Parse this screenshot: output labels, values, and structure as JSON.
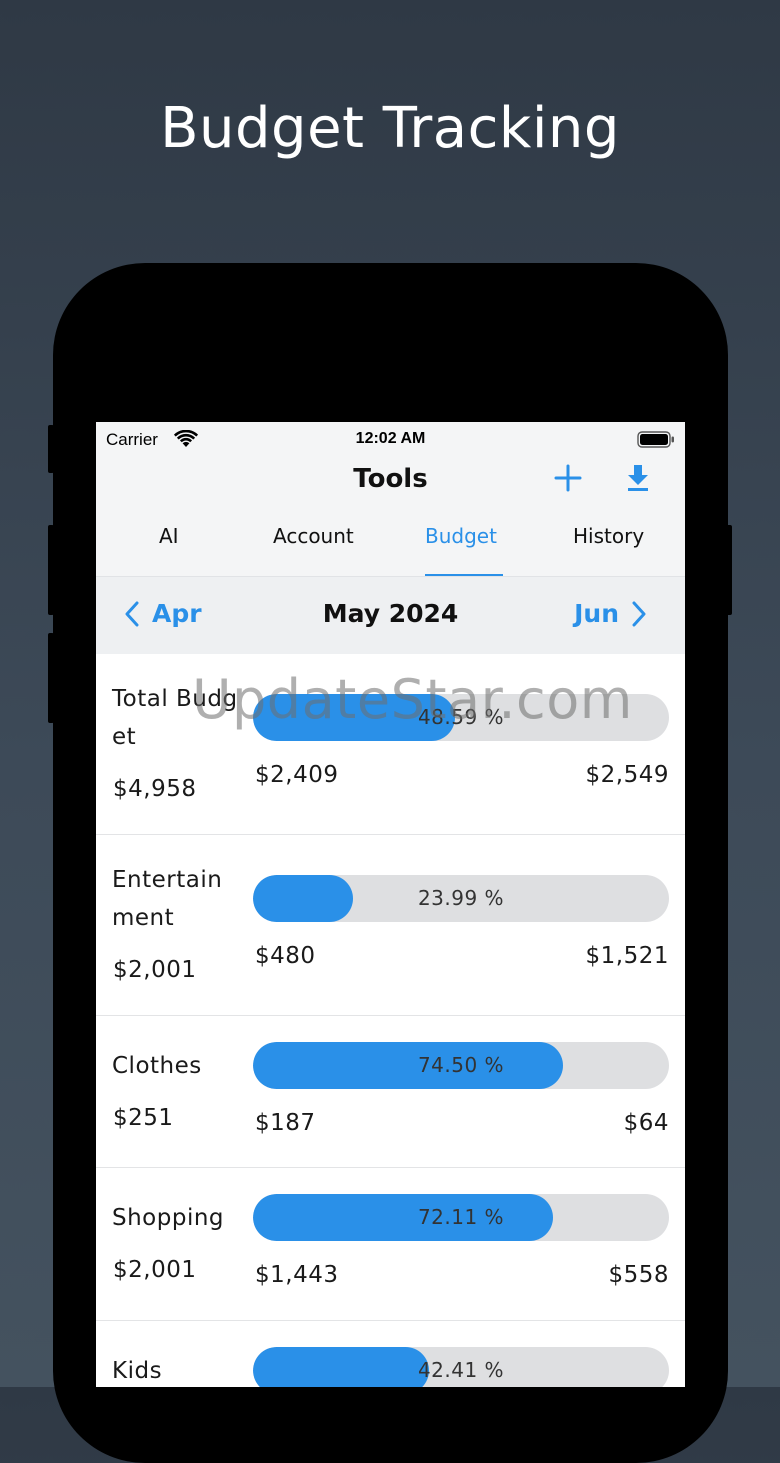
{
  "promo": {
    "title": "Budget Tracking"
  },
  "status_bar": {
    "carrier": "Carrier",
    "time": "12:02 AM"
  },
  "nav": {
    "title": "Tools",
    "add_icon": "plus-icon",
    "download_icon": "download-icon"
  },
  "tabs": [
    {
      "label": "AI",
      "active": false
    },
    {
      "label": "Account",
      "active": false
    },
    {
      "label": "Budget",
      "active": true
    },
    {
      "label": "History",
      "active": false
    }
  ],
  "month_nav": {
    "prev": "Apr",
    "current": "May 2024",
    "next": "Jun"
  },
  "budgets": [
    {
      "name": "Total Budget",
      "total": "$4,958",
      "percent_label": "48.59 %",
      "percent": 48.59,
      "spent": "$2,409",
      "remaining": "$2,549"
    },
    {
      "name": "Entertainment",
      "total": "$2,001",
      "percent_label": "23.99 %",
      "percent": 23.99,
      "spent": "$480",
      "remaining": "$1,521"
    },
    {
      "name": "Clothes",
      "total": "$251",
      "percent_label": "74.50 %",
      "percent": 74.5,
      "spent": "$187",
      "remaining": "$64"
    },
    {
      "name": "Shopping",
      "total": "$2,001",
      "percent_label": "72.11 %",
      "percent": 72.11,
      "spent": "$1,443",
      "remaining": "$558"
    },
    {
      "name": "Kids",
      "total": "",
      "percent_label": "42.41 %",
      "percent": 42.41,
      "spent": "",
      "remaining": ""
    }
  ],
  "watermark": "UpdateStar.com",
  "colors": {
    "accent": "#2a90e8",
    "track": "#dedfe1"
  }
}
